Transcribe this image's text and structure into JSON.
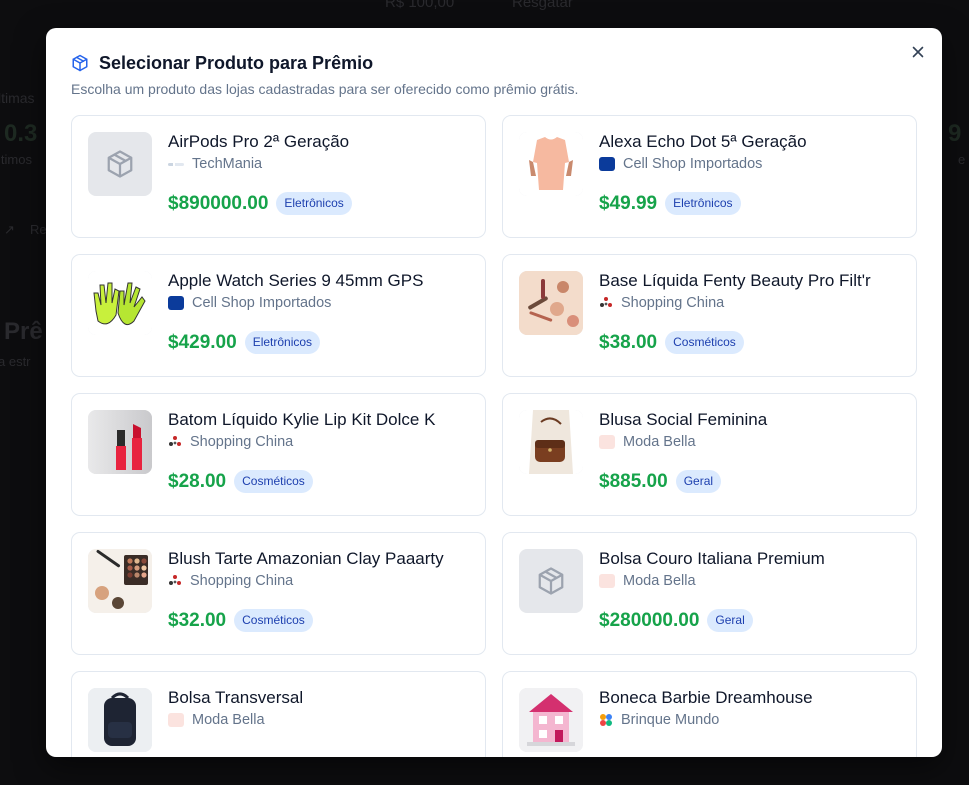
{
  "background": {
    "top_value": "R$ 100,00",
    "top_status": "Resgatar",
    "left_label_1": "ltimas",
    "left_value": "0.3",
    "left_caption": "ltimos",
    "left_link": "Re",
    "left_heading": "Prê",
    "left_sub": "a estr",
    "right_value": "9",
    "right_caption": "e"
  },
  "modal": {
    "title": "Selecionar Produto para Prêmio",
    "subtitle": "Escolha um produto das lojas cadastradas para ser oferecido como prêmio grátis.",
    "close_label": "×",
    "title_icon": "package-icon",
    "placeholder_icon": "package-icon"
  },
  "products": [
    {
      "name": "AirPods Pro 2ª Geração",
      "store": "TechMania",
      "price": "$890000.00",
      "category": "Eletrônicos",
      "thumb": "placeholder",
      "store_logo": "techmania"
    },
    {
      "name": "Alexa Echo Dot 5ª Geração",
      "store": "Cell Shop Importados",
      "price": "$49.99",
      "category": "Eletrônicos",
      "thumb": "shirt",
      "store_logo": "cellshop"
    },
    {
      "name": "Apple Watch Series 9 45mm GPS",
      "store": "Cell Shop Importados",
      "price": "$429.00",
      "category": "Eletrônicos",
      "thumb": "gloves",
      "store_logo": "cellshop"
    },
    {
      "name": "Base Líquida Fenty Beauty Pro Filt'r",
      "store": "Shopping China",
      "price": "$38.00",
      "category": "Cosméticos",
      "thumb": "makeup",
      "store_logo": "china"
    },
    {
      "name": "Batom Líquido Kylie Lip Kit Dolce K",
      "store": "Shopping China",
      "price": "$28.00",
      "category": "Cosméticos",
      "thumb": "lipstick",
      "store_logo": "china"
    },
    {
      "name": "Blusa Social Feminina",
      "store": "Moda Bella",
      "price": "$885.00",
      "category": "Geral",
      "thumb": "bag",
      "store_logo": "moda"
    },
    {
      "name": "Blush Tarte Amazonian Clay Paaarty",
      "store": "Shopping China",
      "price": "$32.00",
      "category": "Cosméticos",
      "thumb": "palette",
      "store_logo": "china"
    },
    {
      "name": "Bolsa Couro Italiana Premium",
      "store": "Moda Bella",
      "price": "$280000.00",
      "category": "Geral",
      "thumb": "placeholder",
      "store_logo": "moda"
    },
    {
      "name": "Bolsa Transversal",
      "store": "Moda Bella",
      "price": "",
      "category": "",
      "thumb": "backpack",
      "store_logo": "moda"
    },
    {
      "name": "Boneca Barbie Dreamhouse",
      "store": "Brinque Mundo",
      "price": "",
      "category": "",
      "thumb": "dollhouse",
      "store_logo": "brinque"
    }
  ],
  "colors": {
    "price": "#16a34a",
    "badge_bg": "#dbeafe",
    "badge_text": "#1e40af",
    "accent_icon": "#2563eb"
  }
}
